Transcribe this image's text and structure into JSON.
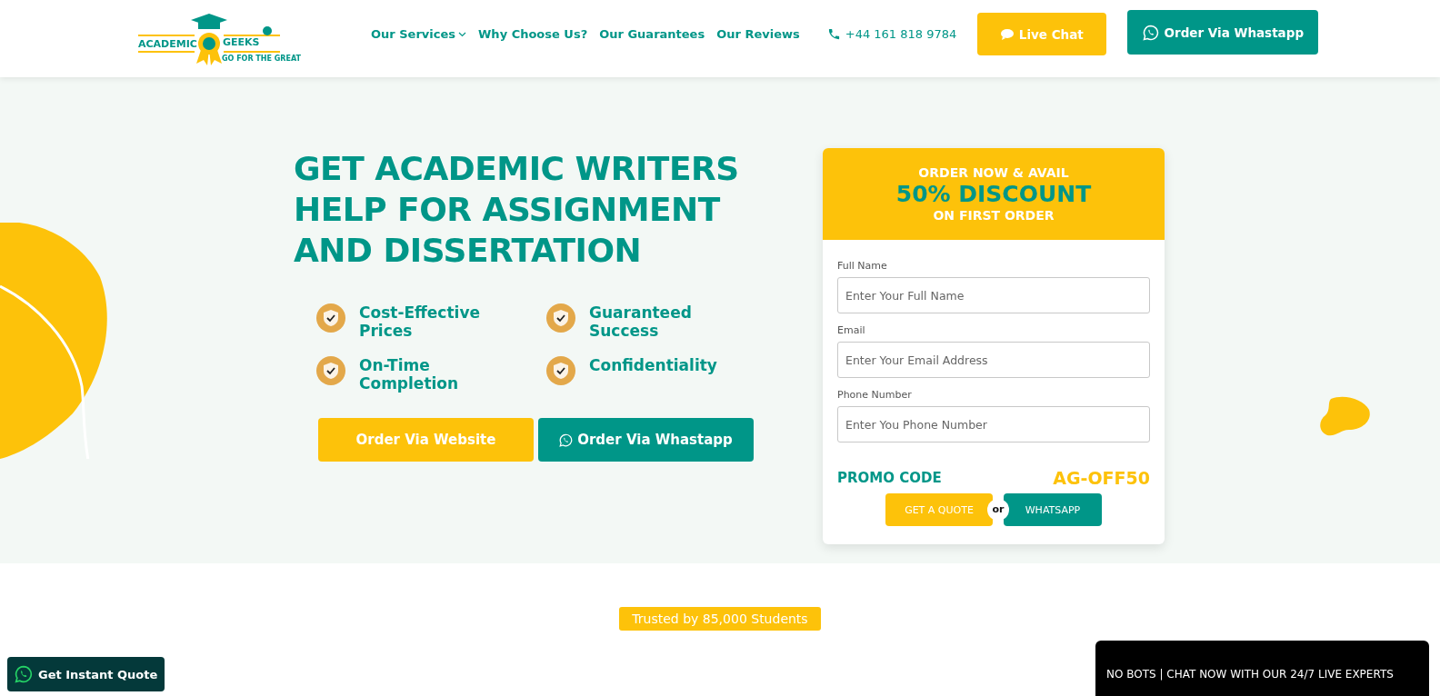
{
  "header": {
    "logo": {
      "left": "ACADEMIC",
      "right": "GEEKS",
      "tagline": "GO FOR THE GREAT"
    },
    "nav": [
      {
        "label": "Our Services",
        "dropdown": true
      },
      {
        "label": "Why Choose Us?",
        "dropdown": false
      },
      {
        "label": "Our Guarantees",
        "dropdown": false
      },
      {
        "label": "Our Reviews",
        "dropdown": false
      }
    ],
    "phone": "+44 161 818 9784",
    "live_chat": "Live Chat",
    "whatsapp": "Order Via Whastapp"
  },
  "hero": {
    "heading": "GET ACADEMIC WRITERS HELP FOR ASSIGNMENT AND DISSERTATION",
    "features": [
      "Cost-Effective Prices",
      "Guaranteed Success",
      "On-Time Completion",
      "Confidentiality"
    ],
    "buttons": [
      {
        "label": "Order Via Website",
        "kind": "website"
      },
      {
        "label": "Order Via Whastapp",
        "kind": "whatsapp"
      }
    ]
  },
  "form": {
    "top": "ORDER NOW & AVAIL",
    "discount": "50% DISCOUNT",
    "bottom": "ON FIRST ORDER",
    "fields": [
      {
        "label": "Full Name",
        "placeholder": "Enter Your Full Name"
      },
      {
        "label": "Email",
        "placeholder": "Enter Your Email Address"
      },
      {
        "label": "Phone Number",
        "placeholder": "Enter You Phone Number"
      }
    ],
    "promo_label": "PROMO CODE",
    "promo_code": "AG-OFF50",
    "quote": "GET A QUOTE",
    "or": "or",
    "whatsapp": "WHATSAPP"
  },
  "trusted": "Trusted by 85,000 Students",
  "instant_quote": "Get Instant Quote",
  "chat_bar": "NO BOTS | CHAT NOW WITH OUR 24/7 LIVE EXPERTS"
}
